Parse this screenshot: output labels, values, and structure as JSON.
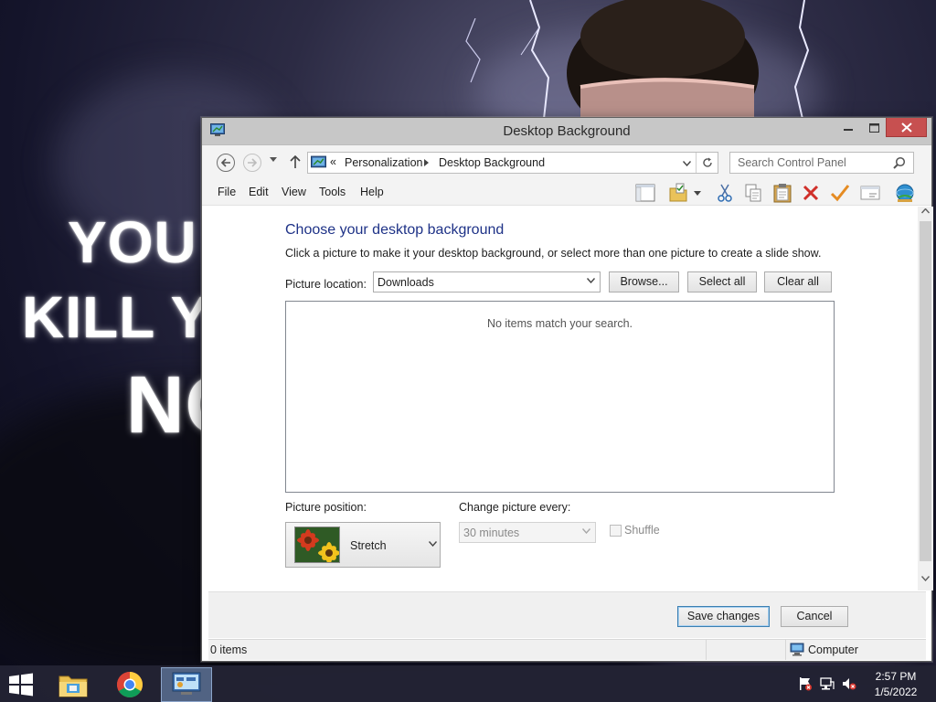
{
  "window": {
    "title": "Desktop Background"
  },
  "address_bar": {
    "overflow": "«",
    "crumbs": [
      "Personalization",
      "Desktop Background"
    ]
  },
  "search": {
    "placeholder": "Search Control Panel"
  },
  "menu": {
    "items": [
      "File",
      "Edit",
      "View",
      "Tools",
      "Help"
    ]
  },
  "toolbar_icons": [
    "layout-icon",
    "folder-options-icon",
    "dropdown-icon",
    "cut-icon",
    "copy-icon",
    "paste-icon",
    "delete-icon",
    "checkmark-icon",
    "properties-icon",
    "globe-icon"
  ],
  "content": {
    "heading": "Choose your desktop background",
    "description": "Click a picture to make it your desktop background, or select more than one picture to create a slide show.",
    "picture_location": {
      "label": "Picture location:",
      "value": "Downloads"
    },
    "buttons": {
      "browse": "Browse...",
      "select_all": "Select all",
      "clear_all": "Clear all"
    },
    "empty_message": "No items match your search.",
    "picture_position": {
      "label": "Picture position:",
      "value": "Stretch"
    },
    "change_picture": {
      "label": "Change picture every:",
      "value": "30 minutes"
    },
    "shuffle": {
      "label": "Shuffle",
      "checked": false
    }
  },
  "footer": {
    "save": "Save changes",
    "cancel": "Cancel"
  },
  "statusbar": {
    "items": "0 items",
    "location": "Computer"
  },
  "taskbar": {
    "apps": [
      "file-explorer",
      "chrome",
      "control-panel"
    ],
    "time": "2:57 PM",
    "date": "1/5/2022"
  },
  "wallpaper": {
    "text_line1": "YOU S",
    "text_line2": "KILL YO",
    "text_line3": "NO"
  },
  "colors": {
    "heading": "#1e3287",
    "close_button": "#c75050",
    "titlebar": "#c7c7c7",
    "default_button_border": "#3c7fb1"
  }
}
